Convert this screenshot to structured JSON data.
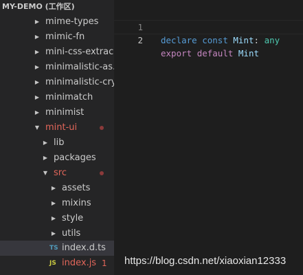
{
  "explorer": {
    "title": "MY-DEMO (工作区)",
    "items": [
      {
        "label": "mime-types"
      },
      {
        "label": "mimic-fn"
      },
      {
        "label": "mini-css-extrac..."
      },
      {
        "label": "minimalistic-as..."
      },
      {
        "label": "minimalistic-cry..."
      },
      {
        "label": "minimatch"
      },
      {
        "label": "minimist"
      },
      {
        "label": "mint-ui",
        "expanded": true,
        "modified": true
      },
      {
        "label": "lib"
      },
      {
        "label": "packages"
      },
      {
        "label": "src",
        "expanded": true,
        "modified": true
      },
      {
        "label": "assets"
      },
      {
        "label": "mixins"
      },
      {
        "label": "style"
      },
      {
        "label": "utils"
      },
      {
        "label": "index.d.ts",
        "type": "TS",
        "selected": true
      },
      {
        "label": "index.js",
        "type": "JS",
        "badge": "1",
        "modified": true
      }
    ]
  },
  "editor": {
    "lines": [
      {
        "number": "1",
        "tokens": [
          "declare",
          "const",
          "Mint",
          ":",
          "any"
        ]
      },
      {
        "number": "2",
        "tokens": [
          "export",
          "default",
          "Mint"
        ]
      }
    ]
  },
  "watermark": "https://blog.csdn.net/xiaoxian12333",
  "colors": {
    "sidebar_bg": "#252526",
    "editor_bg": "#1e1e1e",
    "modified": "#e2665a",
    "keyword": "#569cd6",
    "keyword_control": "#c586c0",
    "identifier": "#9cdcfe",
    "type": "#4ec9b0"
  }
}
